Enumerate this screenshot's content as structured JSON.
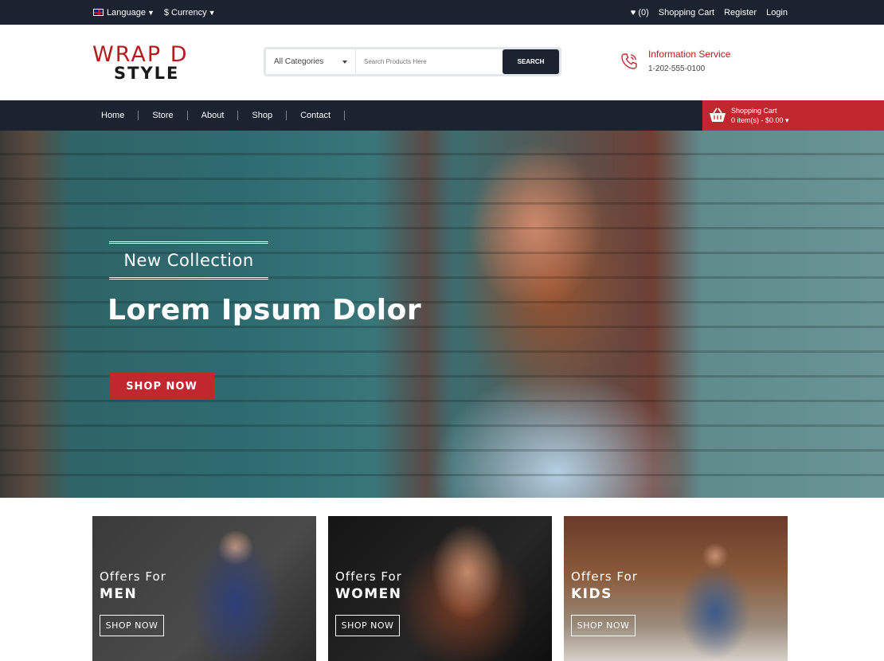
{
  "topbar": {
    "language_label": "Language",
    "currency_label": "$ Currency",
    "wishlist_count": "(0)",
    "shopping_cart": "Shopping Cart",
    "register": "Register",
    "login": "Login"
  },
  "logo": {
    "line1": "WRAP D",
    "line2": "STYLE"
  },
  "search": {
    "category": "All Categories",
    "placeholder": "Search Products Here",
    "button": "SEARCH"
  },
  "info": {
    "title": "Information Service",
    "phone": "1-202-555-0100"
  },
  "nav": {
    "items": [
      {
        "label": "Home"
      },
      {
        "label": "Store"
      },
      {
        "label": "About"
      },
      {
        "label": "Shop"
      },
      {
        "label": "Contact"
      }
    ],
    "cart_title": "Shopping Cart",
    "cart_summary": "0 item(s) - $0.00"
  },
  "hero": {
    "tagline": "New Collection",
    "headline": "Lorem Ipsum Dolor",
    "button": "SHOP NOW"
  },
  "offers": [
    {
      "line1": "Offers For",
      "line2": "MEN",
      "button": "SHOP NOW"
    },
    {
      "line1": "Offers For",
      "line2": "WOMEN",
      "button": "SHOP NOW"
    },
    {
      "line1": "Offers For",
      "line2": "KIDS",
      "button": "SHOP NOW"
    }
  ],
  "colors": {
    "dark": "#1b2330",
    "accent": "#c0282d",
    "brand_red": "#b71c1c"
  },
  "icons": [
    "flag-uk-icon",
    "chevron-down-icon",
    "heart-icon",
    "phone-icon",
    "cart-icon"
  ]
}
